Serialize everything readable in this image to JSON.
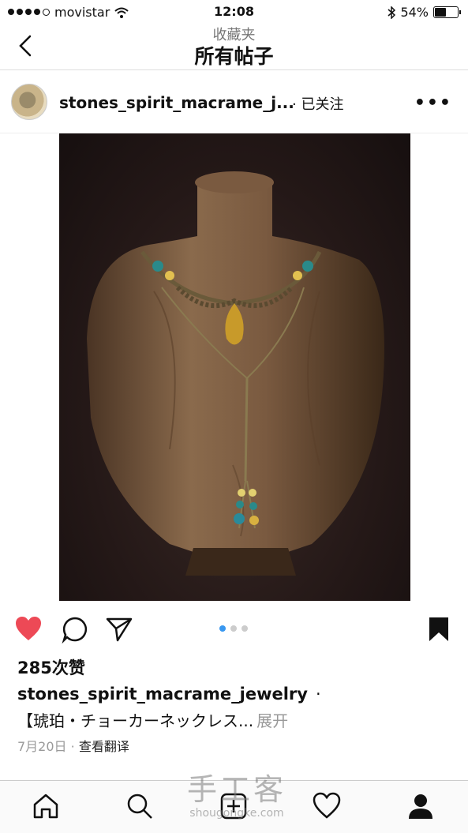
{
  "status_bar": {
    "carrier": "movistar",
    "time": "12:08",
    "battery": "54%",
    "battery_level": 0.54
  },
  "nav": {
    "subtitle": "收藏夹",
    "title": "所有帖子"
  },
  "post": {
    "username": "stones_spirit_macrame_j...",
    "follow_status": "· 已关注",
    "more": "•••",
    "likes": "285次赞",
    "caption_user": "stones_spirit_macrame_jewelry",
    "caption_sep": "·",
    "caption_text": "【琥珀・チョーカーネックレス...",
    "caption_more": "展开",
    "date": "7月20日",
    "meta_sep": " · ",
    "translate": "查看翻译",
    "carousel_total": 3,
    "carousel_active": 1
  },
  "colors": {
    "like_red": "#ed4956",
    "pager_active": "#3897f0"
  },
  "icons": [
    "back-icon",
    "heart-icon",
    "comment-icon",
    "send-icon",
    "bookmark-icon",
    "home-icon",
    "search-icon",
    "add-icon",
    "activity-icon",
    "profile-icon"
  ],
  "watermark": {
    "title": "手工客",
    "url": "shougongke.com"
  }
}
